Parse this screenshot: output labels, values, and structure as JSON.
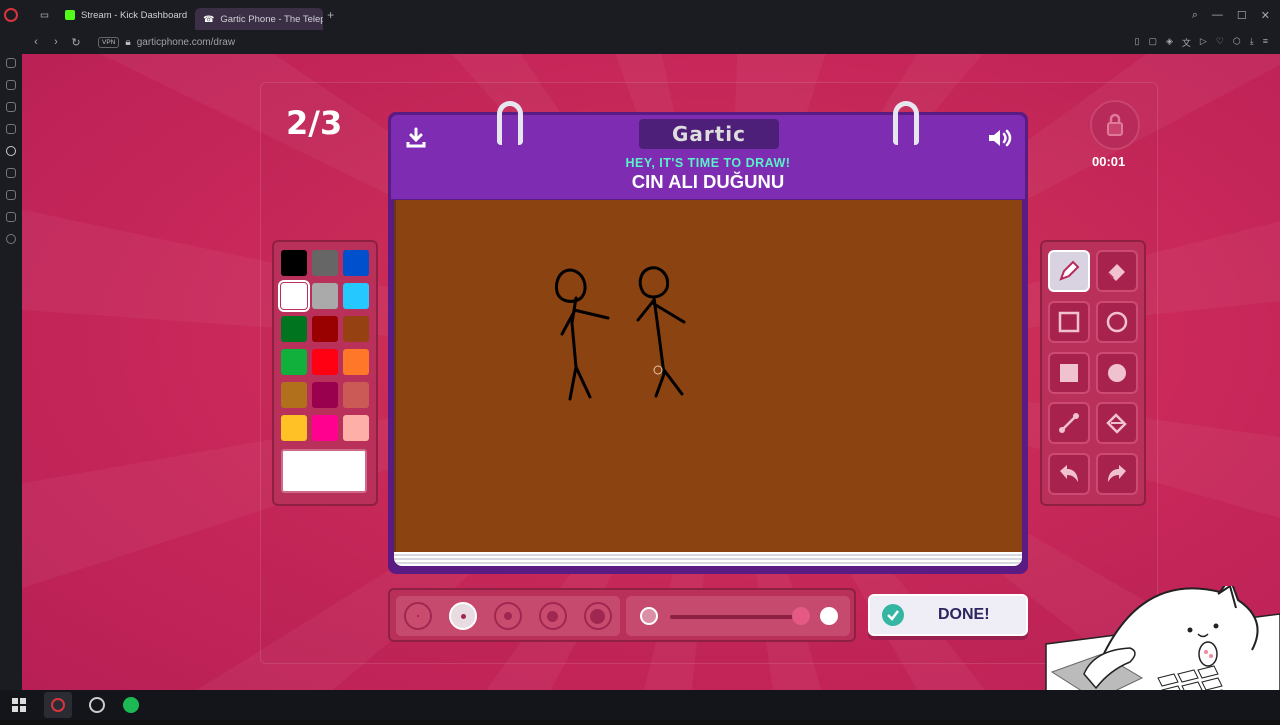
{
  "browser": {
    "tabs": [
      {
        "label": "Stream - Kick Dashboard",
        "active": false,
        "favicon_color": "#53fc18"
      },
      {
        "label": "Gartic Phone - The Telepho",
        "active": true,
        "favicon_color": "#ffffff"
      }
    ],
    "vpn_label": "VPN",
    "url": "garticphone.com/draw"
  },
  "game": {
    "round": "2/3",
    "logo": "Gartic",
    "hint": "HEY, IT'S TIME TO DRAW!",
    "prompt": "CIN ALI DUĞUNU",
    "timer": "00:01",
    "done_label": "DONE!",
    "palette": [
      "#000000",
      "#666666",
      "#0050cd",
      "#ffffff",
      "#aaaaaa",
      "#26c9ff",
      "#017420",
      "#990000",
      "#964112",
      "#11b03c",
      "#ff0013",
      "#ff7829",
      "#b0701c",
      "#99004e",
      "#cb5a57",
      "#ffc126",
      "#ff008f",
      "#feafa8"
    ],
    "selected_color_index": 3,
    "current_color": "#ffffff",
    "canvas_color": "#8a4311",
    "tools": [
      "pen-icon",
      "eraser-icon",
      "rectangle-outline-icon",
      "circle-outline-icon",
      "rectangle-fill-icon",
      "circle-fill-icon",
      "line-icon",
      "fill-bucket-icon",
      "undo-icon",
      "redo-icon"
    ],
    "selected_tool_index": 0,
    "brush_sizes": [
      1,
      2,
      3,
      4,
      5
    ],
    "selected_size_index": 1,
    "opacity": 1
  }
}
